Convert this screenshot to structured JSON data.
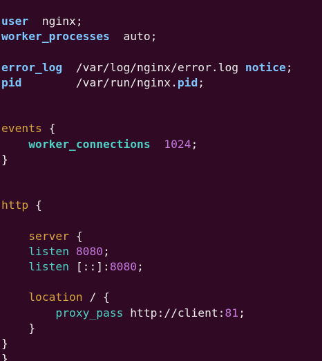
{
  "editor": {
    "lines": [
      [
        {
          "t": "user",
          "c": "directive-top"
        },
        {
          "t": "  nginx;",
          "c": "plain"
        }
      ],
      [
        {
          "t": "worker_processes",
          "c": "directive-top"
        },
        {
          "t": "  auto;",
          "c": "plain"
        }
      ],
      [],
      [
        {
          "t": "error_log",
          "c": "directive-top"
        },
        {
          "t": "  /var/log/nginx/error.log ",
          "c": "plain"
        },
        {
          "t": "notice",
          "c": "directive-top"
        },
        {
          "t": ";",
          "c": "plain"
        }
      ],
      [
        {
          "t": "pid",
          "c": "directive-top"
        },
        {
          "t": "        /var/run/nginx.",
          "c": "plain"
        },
        {
          "t": "pid",
          "c": "directive-top"
        },
        {
          "t": ";",
          "c": "plain"
        }
      ],
      [],
      [],
      [
        {
          "t": "events",
          "c": "block-kw"
        },
        {
          "t": " {",
          "c": "plain"
        }
      ],
      [
        {
          "t": "    ",
          "c": "plain"
        },
        {
          "t": "worker_connections",
          "c": "directive-inner"
        },
        {
          "t": "  ",
          "c": "plain"
        },
        {
          "t": "1024",
          "c": "num"
        },
        {
          "t": ";",
          "c": "plain"
        }
      ],
      [
        {
          "t": "}",
          "c": "plain"
        }
      ],
      [],
      [],
      [
        {
          "t": "http",
          "c": "block-kw"
        },
        {
          "t": " {",
          "c": "plain"
        }
      ],
      [],
      [
        {
          "t": "    ",
          "c": "plain"
        },
        {
          "t": "server",
          "c": "block-kw"
        },
        {
          "t": " {",
          "c": "plain"
        }
      ],
      [
        {
          "t": "    ",
          "c": "plain"
        },
        {
          "t": "listen",
          "c": "cyan-plain"
        },
        {
          "t": " ",
          "c": "plain"
        },
        {
          "t": "8080",
          "c": "num"
        },
        {
          "t": ";",
          "c": "plain"
        }
      ],
      [
        {
          "t": "    ",
          "c": "plain"
        },
        {
          "t": "listen",
          "c": "cyan-plain"
        },
        {
          "t": " [::]:",
          "c": "plain"
        },
        {
          "t": "8080",
          "c": "num"
        },
        {
          "t": ";",
          "c": "plain"
        }
      ],
      [],
      [
        {
          "t": "    ",
          "c": "plain"
        },
        {
          "t": "location",
          "c": "block-kw"
        },
        {
          "t": " / {",
          "c": "plain"
        }
      ],
      [
        {
          "t": "        ",
          "c": "plain"
        },
        {
          "t": "proxy_pass",
          "c": "cyan-plain"
        },
        {
          "t": " http://client:",
          "c": "plain"
        },
        {
          "t": "81",
          "c": "num"
        },
        {
          "t": ";",
          "c": "plain"
        }
      ],
      [
        {
          "t": "    }",
          "c": "plain"
        }
      ],
      [
        {
          "t": "}",
          "c": "plain"
        }
      ],
      [
        {
          "t": "}",
          "c": "plain"
        }
      ]
    ]
  },
  "colors": {
    "background": "#300a24",
    "text": "#eeeeec",
    "directive": "#7ec7ff",
    "block_keyword": "#d8a53a",
    "number": "#c678dd",
    "inner_directive": "#4fd1c5"
  }
}
